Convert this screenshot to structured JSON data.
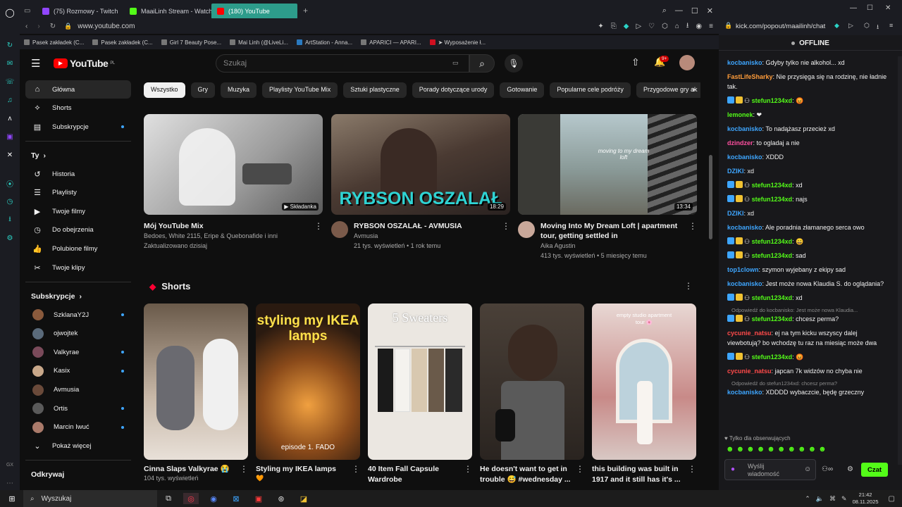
{
  "browser": {
    "tabs": [
      {
        "label": "(75) Rozmowy - Twitch",
        "color": "#9146ff"
      },
      {
        "label": "MaaiLinh Stream - Watch",
        "color": "#53fc18"
      },
      {
        "label": "(180) YouTube",
        "color": "#ff0000"
      }
    ],
    "url": "www.youtube.com",
    "bookmarks": [
      "Pasek zakładek (C...",
      "Pasek zakładek (C...",
      "Girl 7 Beauty Pose...",
      "Mai Linh (@LiveLi...",
      "ArtStation - Anna...",
      "APARICI — APARI...",
      "➤ Wyposażenie ł..."
    ]
  },
  "yt": {
    "logo": "YouTube",
    "region": "PL",
    "search_placeholder": "Szukaj",
    "notif_count": "9+",
    "sidebar": {
      "main": [
        {
          "label": "Główna",
          "icon": "home-icon"
        },
        {
          "label": "Shorts",
          "icon": "shorts-icon"
        },
        {
          "label": "Subskrypcje",
          "icon": "subscriptions-icon"
        }
      ],
      "you_title": "Ty",
      "you": [
        {
          "label": "Historia",
          "icon": "history-icon"
        },
        {
          "label": "Playlisty",
          "icon": "playlist-icon"
        },
        {
          "label": "Twoje filmy",
          "icon": "video-icon"
        },
        {
          "label": "Do obejrzenia",
          "icon": "clock-icon"
        },
        {
          "label": "Polubione filmy",
          "icon": "like-icon"
        },
        {
          "label": "Twoje klipy",
          "icon": "scissors-icon"
        }
      ],
      "subs_title": "Subskrypcje",
      "subs": [
        {
          "label": "SzklanaY2J",
          "color": "#8a5a3c"
        },
        {
          "label": "ojwojtek",
          "color": "#5a6a7a"
        },
        {
          "label": "Valkyrae",
          "color": "#7a4a5a"
        },
        {
          "label": "Kasix",
          "color": "#c9a88a"
        },
        {
          "label": "Avmusia",
          "color": "#6a4a3a"
        },
        {
          "label": "Ortis",
          "color": "#5a5a5a"
        },
        {
          "label": "Marcin Iwuć",
          "color": "#aa7a6a"
        }
      ],
      "show_more": "Pokaż więcej",
      "discover": "Odkrywaj"
    },
    "chips": [
      "Wszystko",
      "Gry",
      "Muzyka",
      "Playlisty YouTube Mix",
      "Sztuki plastyczne",
      "Porady dotyczące urody",
      "Gotowanie",
      "Popularne cele podróży",
      "Przygodowe gry ak"
    ],
    "videos": [
      {
        "title": "Mój YouTube Mix",
        "meta1": "Bedoes, White 2115, Eripe & Quebonafide i inni",
        "meta2": "Zaktualizowano dzisiaj",
        "badge": "▶ Składanka",
        "bg": "#c9c9c9",
        "avatar": ""
      },
      {
        "title": "RYBSON OSZALAŁ - AVMUSIA",
        "meta1": "Avmusia",
        "meta2": "21 tys. wyświetleń • 1 rok temu",
        "badge": "18:29",
        "overlay": "RYBSON OSZALAŁ",
        "bg": "#5a4a42",
        "avatar": "#7a5a4a"
      },
      {
        "title": "Moving Into My Dream Loft | apartment tour, getting settled in",
        "meta1": "Aika Agustin",
        "meta2": "413 tys. wyświetleń • 5 miesięcy temu",
        "badge": "13:34",
        "overlay": "moving to my dream loft",
        "bg": "#9aa6a0",
        "avatar": "#c9a89a"
      }
    ],
    "shorts_title": "Shorts",
    "shorts": [
      {
        "title": "Cinna Slaps Valkyrae 😭",
        "meta": "104 tys. wyświetleń",
        "bg": "#c8b8a8"
      },
      {
        "title": "Styling my IKEA lamps",
        "meta": "🧡",
        "overlay": "styling my IKEA lamps",
        "overlay2": "episode 1. FADO",
        "bg": "#3a2a1a"
      },
      {
        "title": "40 Item Fall Capsule Wardrobe",
        "meta": "",
        "overlay": "5 Sweaters",
        "bg": "#e8e4de"
      },
      {
        "title": "He doesn't want to get in trouble 😅 #wednesday ...",
        "meta": "",
        "bg": "#5a4a3a"
      },
      {
        "title": "this building was built in 1917 and it still has it's ...",
        "meta": "",
        "overlay": "empty studio apartment tour 🌸",
        "bg": "#d8c4c0"
      }
    ]
  },
  "chat": {
    "url": "kick.com/popout/maailinh/chat",
    "status": "OFFLINE",
    "messages": [
      {
        "user": "kocbanisko",
        "color": "#3ea6ff",
        "text": "Gdyby tylko nie alkohol... xd"
      },
      {
        "user": "FastLifeSharky",
        "color": "#ff9c3a",
        "text": "Nie przysięga się na rodzinę, nie ładnie tak."
      },
      {
        "user": "stefun1234xd",
        "color": "#53fc18",
        "text": "😡",
        "badges": true
      },
      {
        "user": "lemonek",
        "color": "#53fc18",
        "text": "❤"
      },
      {
        "user": "kocbanisko",
        "color": "#3ea6ff",
        "text": "To nadążasz przecież xd"
      },
      {
        "user": "dzindzer",
        "color": "#ff4fa0",
        "text": "to ogladaj a nie"
      },
      {
        "user": "kocbanisko",
        "color": "#3ea6ff",
        "text": "XDDD"
      },
      {
        "user": "DZIKI",
        "color": "#3ea6ff",
        "text": "xd"
      },
      {
        "user": "stefun1234xd",
        "color": "#53fc18",
        "text": "xd",
        "badges": true
      },
      {
        "user": "stefun1234xd",
        "color": "#53fc18",
        "text": "najs",
        "badges": true
      },
      {
        "user": "DZIKI",
        "color": "#3ea6ff",
        "text": "xd"
      },
      {
        "user": "kocbanisko",
        "color": "#3ea6ff",
        "text": "Ale poradnia złamanego serca owo"
      },
      {
        "user": "stefun1234xd",
        "color": "#53fc18",
        "text": "😄",
        "badges": true
      },
      {
        "user": "stefun1234xd",
        "color": "#53fc18",
        "text": "sad",
        "badges": true
      },
      {
        "user": "top1clown",
        "color": "#3ea6ff",
        "text": "szymon wyjebany z ekipy sad"
      },
      {
        "user": "kocbanisko",
        "color": "#3ea6ff",
        "text": "Jest może nowa Klaudia S. do oglądania?"
      },
      {
        "user": "stefun1234xd",
        "color": "#53fc18",
        "text": "xd",
        "badges": true
      },
      {
        "reply": "Odpowiedź do kocbanisko: Jest może nowa Klaudia..."
      },
      {
        "user": "stefun1234xd",
        "color": "#53fc18",
        "text": "chcesz perma?",
        "badges": true
      },
      {
        "user": "cycunie_natsu",
        "color": "#ff4a4a",
        "text": "ej na tym kicku wszyscy dalej viewbotują? bo wchodzę tu raz na miesiąc może dwa"
      },
      {
        "user": "stefun1234xd",
        "color": "#53fc18",
        "text": "😡",
        "badges": true
      },
      {
        "user": "cycunie_natsu",
        "color": "#ff4a4a",
        "text": "japcan 7k widzów no chyba nie"
      },
      {
        "reply": "Odpowiedź do stefun1234xd: chcesz perma?"
      },
      {
        "user": "kocbanisko",
        "color": "#3ea6ff",
        "text": "XDDDD wybaczcie, będę grzeczny"
      }
    ],
    "followers_only": "Tylko dla obserwujących",
    "input_placeholder": "Wyślij wiadomość",
    "send": "Czat"
  },
  "taskbar": {
    "search": "Wyszukaj",
    "time": "21:42",
    "date": "08.11.2025"
  }
}
